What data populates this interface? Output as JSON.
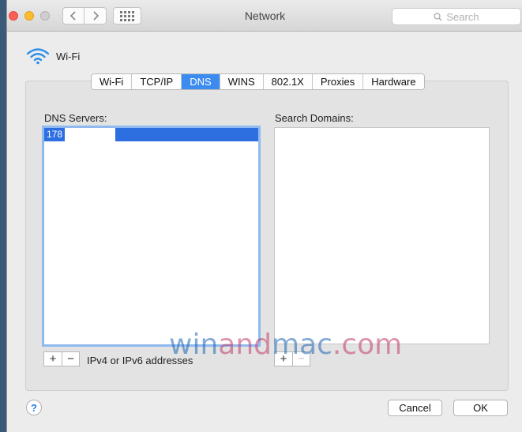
{
  "window": {
    "title": "Network",
    "search_placeholder": "Search"
  },
  "interface": {
    "name": "Wi-Fi"
  },
  "tabs": [
    {
      "label": "Wi-Fi",
      "active": false
    },
    {
      "label": "TCP/IP",
      "active": false
    },
    {
      "label": "DNS",
      "active": true
    },
    {
      "label": "WINS",
      "active": false
    },
    {
      "label": "802.1X",
      "active": false
    },
    {
      "label": "Proxies",
      "active": false
    },
    {
      "label": "Hardware",
      "active": false
    }
  ],
  "dns": {
    "servers_label": "DNS Servers:",
    "servers": [
      "178"
    ],
    "domains_label": "Search Domains:",
    "hint": "IPv4 or IPv6 addresses"
  },
  "controls": {
    "plus": "+",
    "minus": "−"
  },
  "buttons": {
    "help": "?",
    "cancel": "Cancel",
    "ok": "OK"
  },
  "watermark": {
    "part1": "win",
    "part2": "and",
    "part3": "mac",
    "part4": ".com"
  },
  "colors": {
    "accent": "#3b8bf0",
    "selection": "#2d6ee0"
  }
}
